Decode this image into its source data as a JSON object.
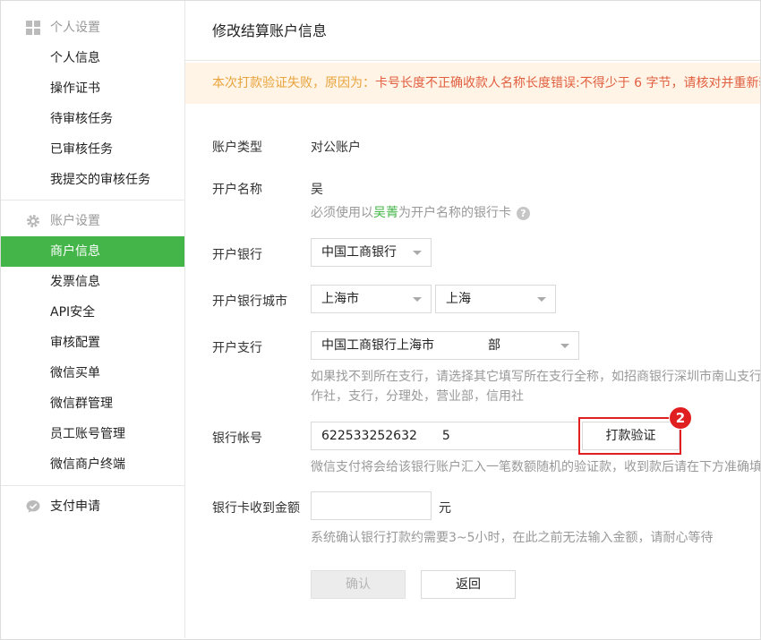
{
  "sidebar": {
    "section_personal": "个人设置",
    "personal_items": [
      "个人信息",
      "操作证书",
      "待审核任务",
      "已审核任务",
      "我提交的审核任务"
    ],
    "section_account": "账户设置",
    "account_items": [
      "商户信息",
      "发票信息",
      "API安全",
      "审核配置",
      "微信买单",
      "微信群管理",
      "员工账号管理",
      "微信商户终端"
    ],
    "section_payment": "支付申请"
  },
  "main": {
    "title": "修改结算账户信息",
    "alert_prefix": "本次打款验证失败，原因为：",
    "alert_reason": "卡号长度不正确收款人名称长度错误:不得少于 6 字节，请核对并重新输入",
    "form": {
      "account_type_label": "账户类型",
      "account_type_value": "对公账户",
      "account_name_label": "开户名称",
      "account_name_value": "吴",
      "name_hint_pre": "必须使用以",
      "name_hint_name": "吴菁",
      "name_hint_post": "为开户名称的银行卡",
      "bank_label": "开户银行",
      "bank_value": "中国工商银行",
      "city_label": "开户银行城市",
      "province_value": "上海市",
      "city_value": "上海",
      "branch_label": "开户支行",
      "branch_value": "中国工商银行上海市",
      "branch_value_tail": "部",
      "branch_hint_line1": "如果找不到所在支行，请选择其它填写所在支行全称，如招商银行深圳市南山支行",
      "branch_hint_line2": "作社，支行，分理处，营业部，信用社",
      "account_no_label": "银行帐号",
      "account_no_value": "622533252632",
      "account_no_tail": "5",
      "verify_button": "打款验证",
      "account_no_hint": "微信支付将会给该银行账户汇入一笔数额随机的验证款，收到款后请在下方准确填写",
      "amount_label": "银行卡收到金额",
      "amount_value": "",
      "amount_unit": "元",
      "amount_hint": "系统确认银行打款约需要3~5小时，在此之前无法输入金额，请耐心等待",
      "confirm_button": "确认",
      "back_button": "返回"
    },
    "annotation_number": "2"
  },
  "colors": {
    "accent_green": "#44b549",
    "alert_bg": "#fff4e5",
    "alert_orange": "#e8a33c",
    "alert_red": "#e15f41",
    "annotation_red": "#e02020"
  }
}
